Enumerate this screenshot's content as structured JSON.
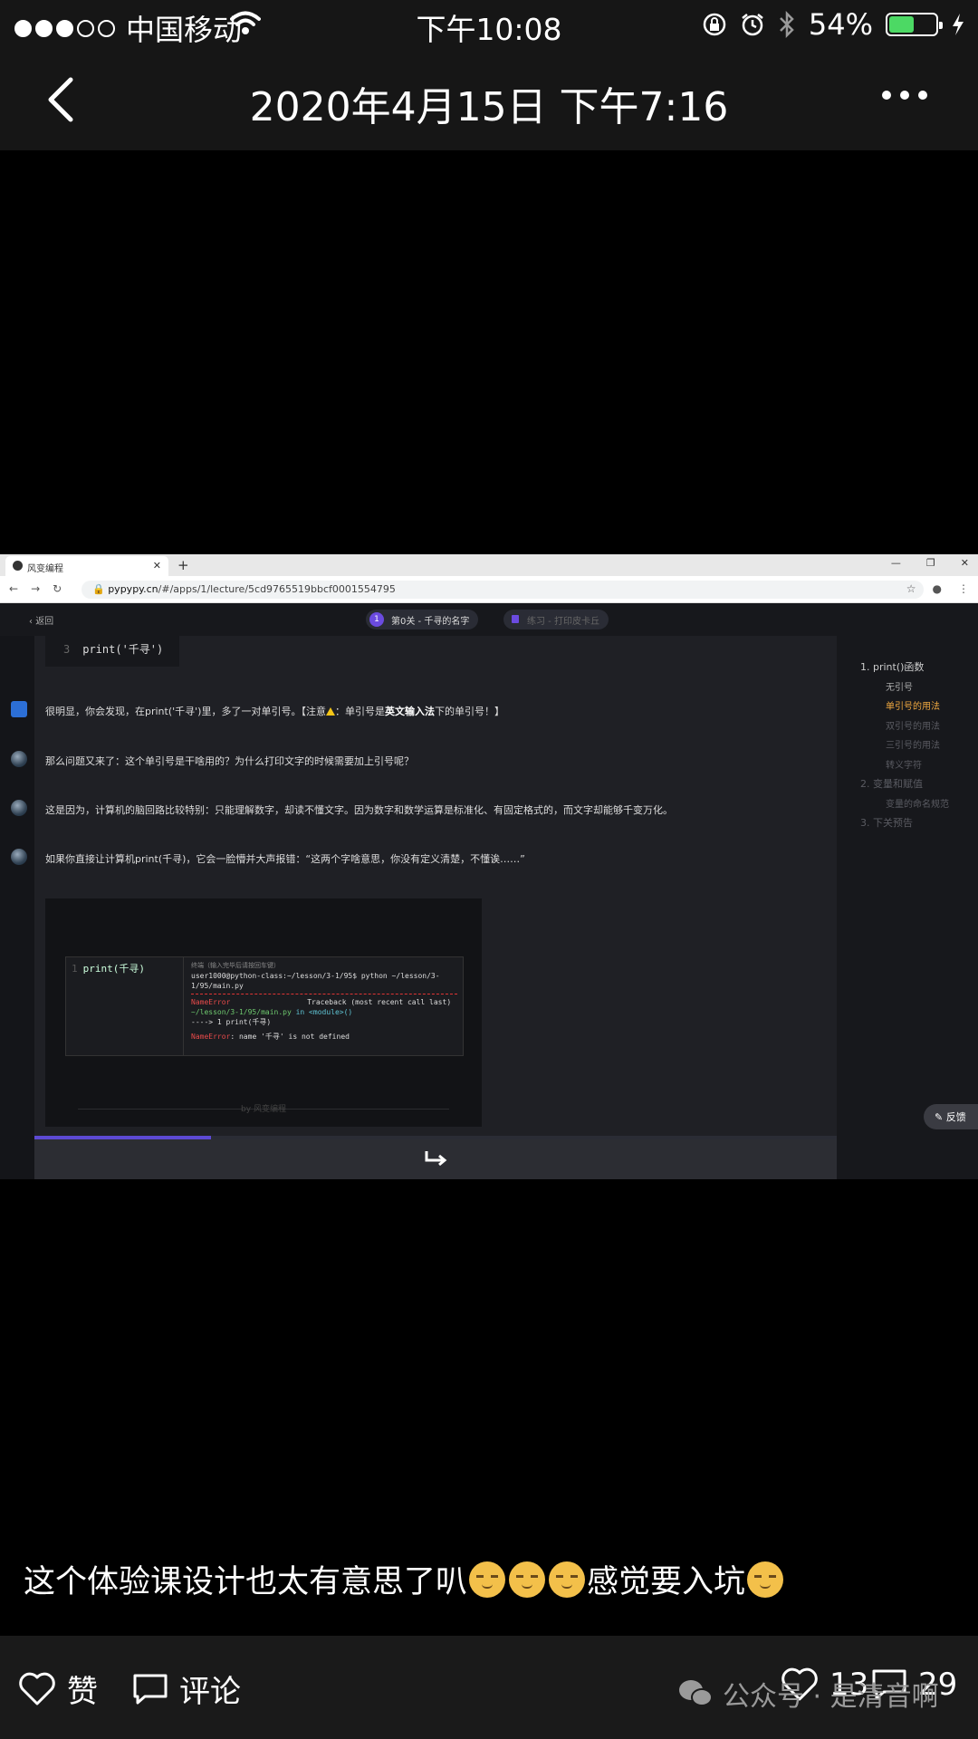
{
  "status_bar": {
    "carrier": "中国移动",
    "time": "下午10:08",
    "battery": "54%",
    "battery_level": 0.54
  },
  "nav": {
    "title": "2020年4月15日 下午7:16"
  },
  "browser": {
    "tab_title": "风变编程",
    "url_domain": "pypypy.cn",
    "url_path": "/#/apps/1/lecture/5cd9765519bbcf0001554795"
  },
  "app": {
    "back_label": "返回",
    "level_number": "1",
    "level_label": "第0关 - 千寻的名字",
    "practice_label": "练习 - 打印皮卡丘"
  },
  "lesson": {
    "code_line_number": "3",
    "code_line": "print('千寻')",
    "msg1_a": "很明显，你会发现，在print('千寻')里，多了一对单引号。【注意",
    "msg1_b": "：单引号是",
    "msg1_bold": "英文输入法",
    "msg1_c": "下的单引号！】",
    "msg2": "那么问题又来了：这个单引号是干啥用的？为什么打印文字的时候需要加上引号呢？",
    "msg3": "这是因为，计算机的脑回路比较特别：只能理解数字，却读不懂文字。因为数字和数学运算是标准化、有固定格式的，而文字却能够千变万化。",
    "msg4": "如果你直接让计算机print(千寻)，它会一脸懵并大声报错：“这两个字啥意思，你没有定义清楚，不懂诶……”"
  },
  "error_card": {
    "code_line_number": "1",
    "code": "print(千寻)",
    "terminal_hint": "终端（输入完毕后请按回车键）",
    "command": "user1000@python-class:~/lesson/3-1/95$ python ~/lesson/3-1/95/main.py",
    "error_name": "NameError",
    "traceback": "Traceback (most recent call last)",
    "file_line": "~/lesson/3-1/95/main.py",
    "in_module": "in <module>()",
    "arrow_line": "----> 1 print(千寻)",
    "message": ": name '千寻' is not defined",
    "footer": "by 风变编程"
  },
  "progress": 0.22,
  "toc": {
    "items": [
      {
        "label": "1. print()函数",
        "level": 1,
        "state": "normal"
      },
      {
        "label": "无引号",
        "level": 2,
        "state": "normal"
      },
      {
        "label": "单引号的用法",
        "level": 2,
        "state": "active"
      },
      {
        "label": "双引号的用法",
        "level": 2,
        "state": "dim"
      },
      {
        "label": "三引号的用法",
        "level": 2,
        "state": "dim"
      },
      {
        "label": "转义字符",
        "level": 2,
        "state": "dim"
      },
      {
        "label": "2. 变量和赋值",
        "level": 1,
        "state": "dim"
      },
      {
        "label": "变量的命名规范",
        "level": 2,
        "state": "dim"
      },
      {
        "label": "3. 下关预告",
        "level": 1,
        "state": "dim"
      }
    ],
    "feedback_label": "反馈"
  },
  "post": {
    "caption_text": "这个体验课设计也太有意思了叭",
    "caption_text2": "感觉要入坑"
  },
  "actions": {
    "like_label": "赞",
    "comment_label": "评论",
    "like_count": "13",
    "comment_count": "29",
    "watermark": "公众号 · 是清音啊"
  },
  "colors": {
    "accent_purple": "#5d4ad4",
    "toc_active": "#f0a940",
    "battery_green": "#4cd964"
  }
}
